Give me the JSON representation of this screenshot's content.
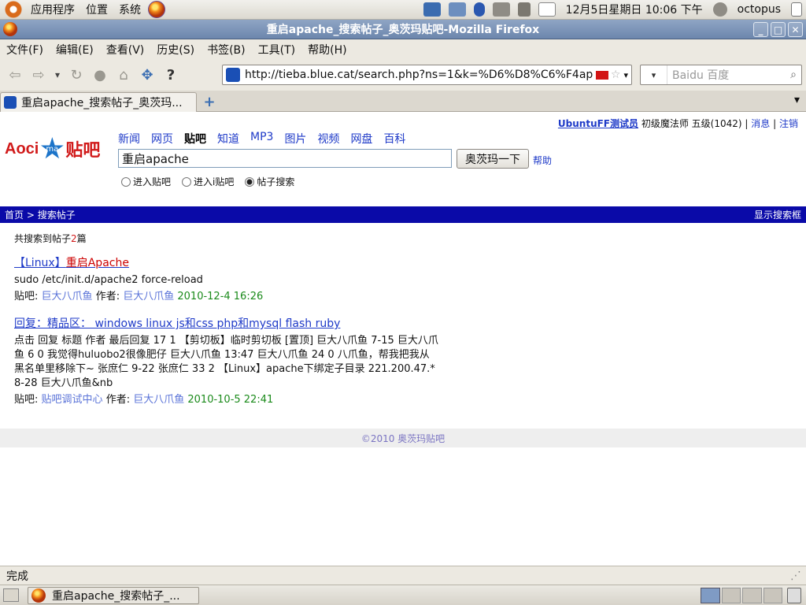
{
  "top_panel": {
    "menus": [
      "应用程序",
      "位置",
      "系统"
    ],
    "clock": "12月5日星期日 10:06 下午",
    "user": "octopus"
  },
  "window": {
    "title": "重启apache_搜索帖子_奥茨玛贴吧-Mozilla Firefox"
  },
  "menubar": [
    "文件(F)",
    "编辑(E)",
    "查看(V)",
    "历史(S)",
    "书签(B)",
    "工具(T)",
    "帮助(H)"
  ],
  "navbar": {
    "url": "http://tieba.blue.cat/search.php?ns=1&k=%D6%D8%C6%F4apache",
    "search_placeholder": "Baidu 百度"
  },
  "tab": {
    "label": "重启apache_搜索帖子_奥茨玛..."
  },
  "page": {
    "user": {
      "name": "UbuntuFF测试员",
      "rank": "初级魔法师 五级(1042)",
      "messages": "消息",
      "logout": "注销",
      "sep": "|"
    },
    "logo": {
      "aoci": "Aoci",
      "ma": "ma",
      "tieba": "贴吧"
    },
    "channels": [
      "新闻",
      "网页",
      "贴吧",
      "知道",
      "MP3",
      "图片",
      "视频",
      "网盘",
      "百科"
    ],
    "query": "重启apache",
    "search_button": "奥茨玛一下",
    "help": "帮助",
    "radios": [
      "进入贴吧",
      "进入i贴吧",
      "帖子搜索"
    ],
    "breadcrumb": {
      "home": "首页",
      "sep": " > ",
      "current": "搜索帖子",
      "toggle": "显示搜索框"
    },
    "count": {
      "prefix": "共搜索到帖子",
      "number": "2",
      "suffix": "篇"
    },
    "results": [
      {
        "title_pre": "【Linux】",
        "title_hl": "重启Apache",
        "snippet": "sudo /etc/init.d/apache2 force-reload",
        "bar_label": "贴吧:",
        "bar": "巨大八爪鱼",
        "author_label": "作者:",
        "author": "巨大八爪鱼",
        "date": "2010-12-4 16:26"
      },
      {
        "title_pre": "回复：精品区： windows linux js和css php和mysql flash ruby",
        "title_hl": "",
        "snippet": "点击 回复 标题 作者 最后回复 17 1 【剪切板】临时剪切板 [置顶] 巨大八爪鱼 7-15 巨大八爪鱼 6 0 我觉得huluobo2很像肥仔 巨大八爪鱼 13:47 巨大八爪鱼 24 0 八爪鱼，帮我把我从黑名单里移除下~ 张庶仁 9-22 张庶仁 33 2 【Linux】apache下绑定子目录 221.200.47.* 8-28 巨大八爪鱼&nb",
        "bar_label": "贴吧:",
        "bar": "贴吧调试中心",
        "author_label": "作者:",
        "author": "巨大八爪鱼",
        "date": "2010-10-5 22:41"
      }
    ],
    "footer": "©2010 奥茨玛贴吧"
  },
  "status": "完成",
  "taskbar": {
    "window_button": "重启apache_搜索帖子_..."
  }
}
